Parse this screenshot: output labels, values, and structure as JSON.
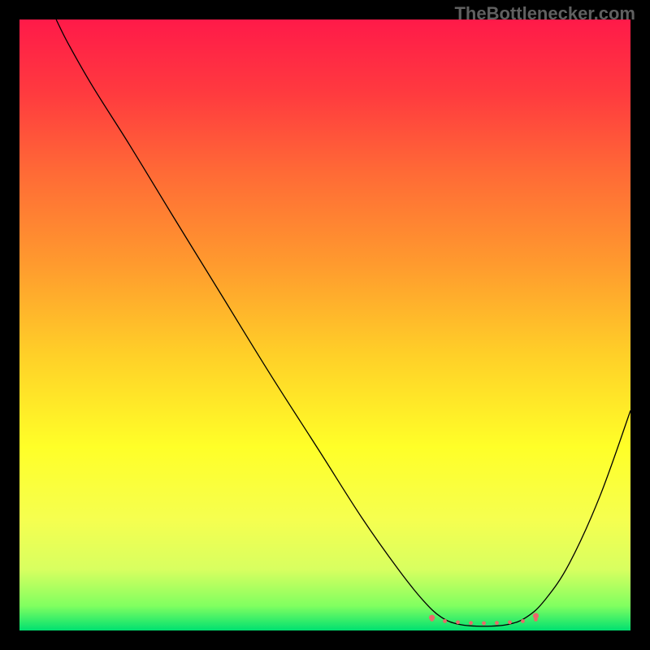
{
  "attribution": "TheBottlenecker.com",
  "chart_data": {
    "type": "line",
    "title": "",
    "xlabel": "",
    "ylabel": "",
    "xlim": [
      0,
      100
    ],
    "ylim": [
      0,
      100
    ],
    "bg_gradient": {
      "stops": [
        {
          "offset": 0,
          "color": "#ff1a49"
        },
        {
          "offset": 12,
          "color": "#ff3a3f"
        },
        {
          "offset": 25,
          "color": "#ff6a36"
        },
        {
          "offset": 40,
          "color": "#ff9a2e"
        },
        {
          "offset": 55,
          "color": "#ffd028"
        },
        {
          "offset": 70,
          "color": "#ffff28"
        },
        {
          "offset": 82,
          "color": "#f5ff50"
        },
        {
          "offset": 90,
          "color": "#d8ff60"
        },
        {
          "offset": 96,
          "color": "#80ff60"
        },
        {
          "offset": 100,
          "color": "#00e070"
        }
      ]
    },
    "series": [
      {
        "name": "bottleneck-curve",
        "color": "#000000",
        "width": 1.3,
        "points": [
          {
            "x": 6.0,
            "y": 100.0
          },
          {
            "x": 8.0,
            "y": 96.0
          },
          {
            "x": 12.0,
            "y": 89.0
          },
          {
            "x": 18.0,
            "y": 79.5
          },
          {
            "x": 25.0,
            "y": 68.0
          },
          {
            "x": 33.0,
            "y": 55.0
          },
          {
            "x": 41.0,
            "y": 42.0
          },
          {
            "x": 49.0,
            "y": 29.5
          },
          {
            "x": 56.0,
            "y": 18.5
          },
          {
            "x": 62.0,
            "y": 10.0
          },
          {
            "x": 66.0,
            "y": 5.0
          },
          {
            "x": 69.0,
            "y": 2.2
          },
          {
            "x": 72.0,
            "y": 1.0
          },
          {
            "x": 76.0,
            "y": 0.7
          },
          {
            "x": 80.0,
            "y": 1.0
          },
          {
            "x": 83.0,
            "y": 2.2
          },
          {
            "x": 86.0,
            "y": 5.0
          },
          {
            "x": 90.0,
            "y": 11.0
          },
          {
            "x": 95.0,
            "y": 22.0
          },
          {
            "x": 100.0,
            "y": 36.0
          }
        ]
      }
    ],
    "marker_band": {
      "color": "#e86a6a",
      "y": 1.8,
      "x_start": 67.5,
      "x_end": 84.5,
      "dot_radius": 2.4,
      "dot_count": 9
    }
  }
}
